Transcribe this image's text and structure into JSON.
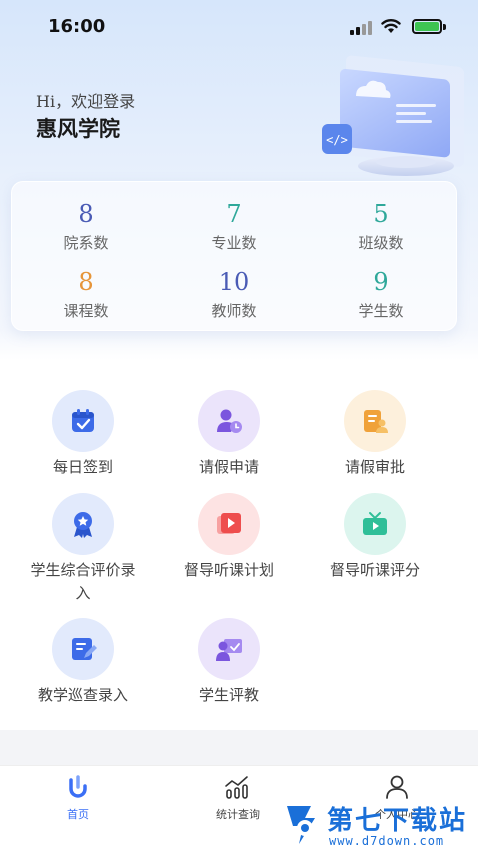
{
  "status_bar": {
    "time": "16:00"
  },
  "header": {
    "greeting": "Hi，欢迎登录",
    "school": "惠风学院"
  },
  "stats": [
    {
      "value": "8",
      "label": "院系数",
      "color": "#4a5bb5"
    },
    {
      "value": "7",
      "label": "专业数",
      "color": "#2fa89a"
    },
    {
      "value": "5",
      "label": "班级数",
      "color": "#2fa89a"
    },
    {
      "value": "8",
      "label": "课程数",
      "color": "#e6953a"
    },
    {
      "value": "10",
      "label": "教师数",
      "color": "#4a5bb5"
    },
    {
      "value": "9",
      "label": "学生数",
      "color": "#2fa89a"
    }
  ],
  "features": [
    {
      "label": "每日签到",
      "icon": "calendar-check-icon",
      "bg": "#e2eafc",
      "fg": "#3d6be8"
    },
    {
      "label": "请假申请",
      "icon": "user-clock-icon",
      "bg": "#ebe4fb",
      "fg": "#7b56de"
    },
    {
      "label": "请假审批",
      "icon": "approval-icon",
      "bg": "#fdf0dc",
      "fg": "#f0a23a"
    },
    {
      "label": "学生综合评价录入",
      "icon": "medal-icon",
      "bg": "#e2eafc",
      "fg": "#3d6be8"
    },
    {
      "label": "督导听课计划",
      "icon": "video-plan-icon",
      "bg": "#fde3e3",
      "fg": "#ee4d4d"
    },
    {
      "label": "督导听课评分",
      "icon": "tv-play-icon",
      "bg": "#dcf5ee",
      "fg": "#2fbf98"
    },
    {
      "label": "教学巡查录入",
      "icon": "edit-doc-icon",
      "bg": "#e2eafc",
      "fg": "#3d6be8"
    },
    {
      "label": "学生评教",
      "icon": "teacher-review-icon",
      "bg": "#ebe4fb",
      "fg": "#7b56de"
    }
  ],
  "tabs": [
    {
      "label": "首页",
      "icon": "home-icon"
    },
    {
      "label": "统计查询",
      "icon": "chart-icon"
    },
    {
      "label": "个人中心",
      "icon": "user-icon"
    }
  ],
  "watermark": {
    "title": "第七下载站",
    "url": "www.d7down.com"
  },
  "colors": {
    "accent": "#3b6ff5",
    "watermark": "#1a6fd8"
  }
}
